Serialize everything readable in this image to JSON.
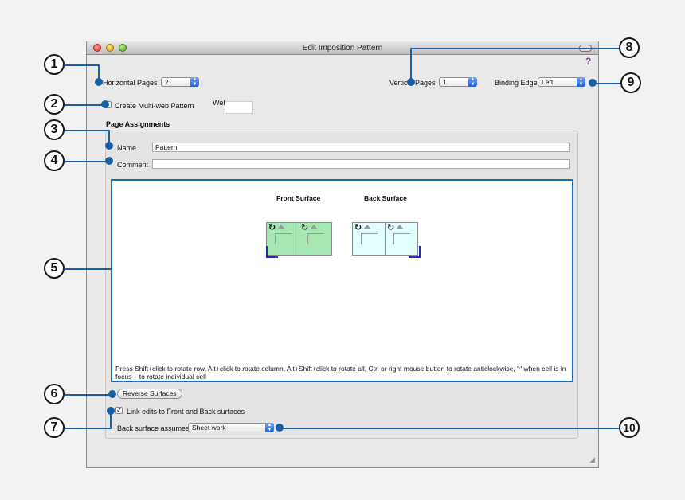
{
  "window": {
    "title": "Edit Imposition Pattern",
    "help_glyph": "?"
  },
  "horizontal_pages": {
    "label": "Horizontal Pages",
    "value": "2"
  },
  "vertical_pages": {
    "label": "Vertical Pages",
    "value": "1"
  },
  "binding_edge": {
    "label": "Binding Edge",
    "value": "Left"
  },
  "multi_web": {
    "label": "Create Multi-web Pattern",
    "checked": false
  },
  "webs": {
    "label": "Webs",
    "value": ""
  },
  "page_assignments": {
    "title": "Page Assignments",
    "name_label": "Name",
    "name_value": "Pattern",
    "comment_label": "Comment",
    "comment_value": ""
  },
  "surfaces": {
    "front_title": "Front Surface",
    "back_title": "Back Surface",
    "instructions": "Press Shift+click to rotate row, Alt+click to rotate column, Alt+Shift+click to rotate all, Ctrl or right mouse button to rotate anticlockwise, 'r' when cell is in focus – to rotate individual cell"
  },
  "reverse_surfaces": {
    "label": "Reverse Surfaces"
  },
  "link_edits": {
    "label": "Link edits to Front and Back surfaces",
    "checked": true
  },
  "back_surface_assumes": {
    "label": "Back surface assumes",
    "value": "Sheet work"
  },
  "icons": {
    "rotate": "rotate-icon",
    "up_arrow": "up-triangle-icon",
    "select_arrows": "updown-arrows-icon",
    "check": "checkmark-icon",
    "resize": "resize-grip-icon"
  },
  "callouts": [
    "1",
    "2",
    "3",
    "4",
    "5",
    "6",
    "7",
    "8",
    "9",
    "10"
  ],
  "colors": {
    "callout_line": "#1a5fa6",
    "front_cell": "#a6e6b3",
    "back_cell": "#e3fdfd",
    "binding_mark": "#1b2fb7",
    "select_accent": "#1f62dc"
  }
}
